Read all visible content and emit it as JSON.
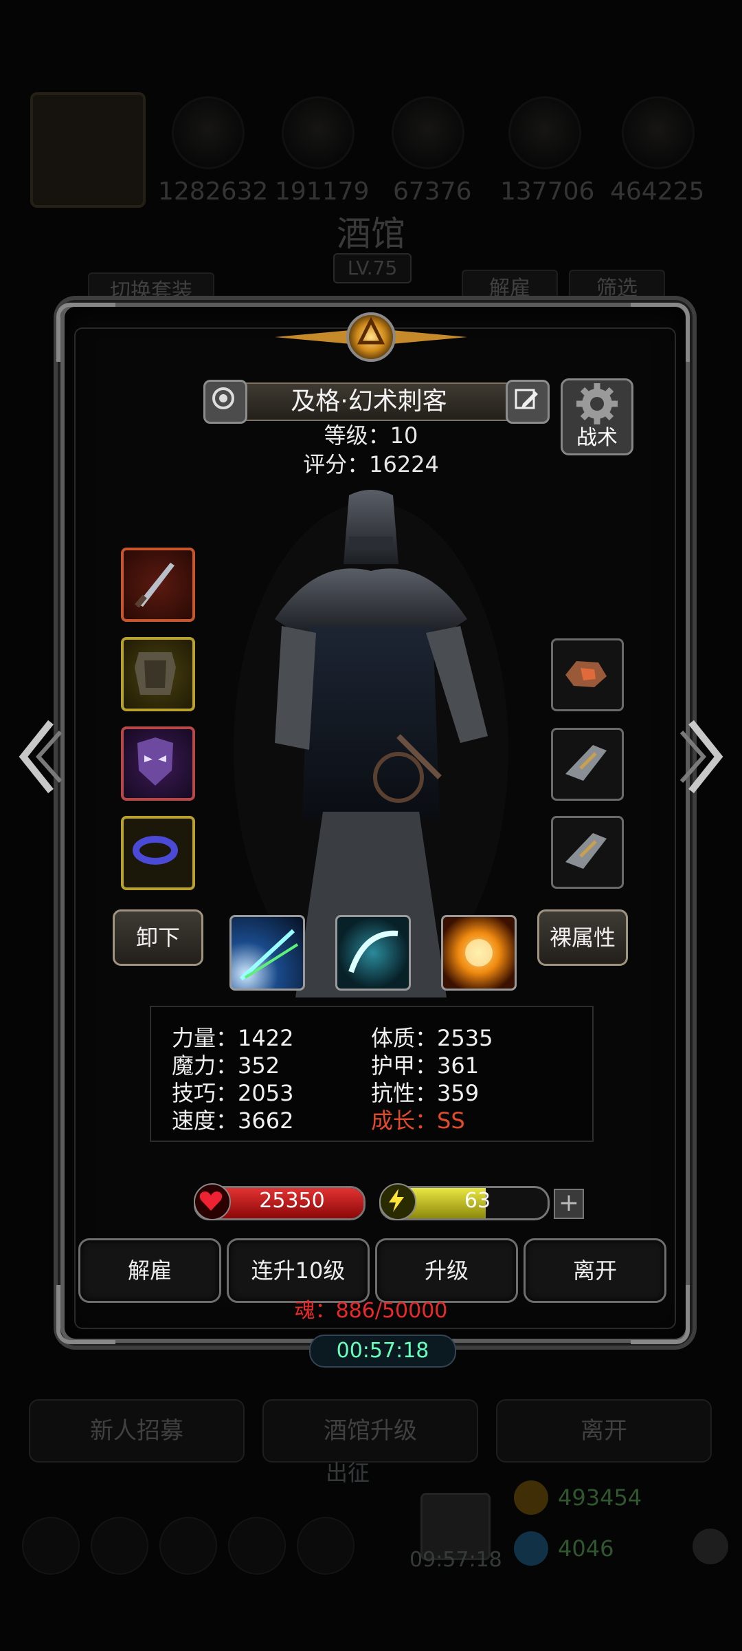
{
  "background": {
    "resources": [
      "1282632",
      "191179",
      "67376",
      "137706",
      "464225"
    ],
    "title": "酒馆",
    "level": "LV.75",
    "switch_outfit": "切换套装",
    "dismiss": "解雇",
    "filter": "筛选",
    "buttons": [
      "新人招募",
      "酒馆升级",
      "离开"
    ],
    "expedition": "出征",
    "gift_timer": "09:57:18",
    "gold": "493454",
    "gems": "4046"
  },
  "hero": {
    "name": "及格·幻术刺客",
    "level_text": "等级：10",
    "score_text": "评分：16224",
    "tactic_label": "战术",
    "unequip_label": "卸下",
    "base_attr_label": "裸属性"
  },
  "equipment": {
    "left": [
      "dagger-icon",
      "armor-icon",
      "mask-icon",
      "bracelet-icon"
    ],
    "right": [
      "ore-icon",
      "gauntlet-icon",
      "gauntlet-icon"
    ]
  },
  "skills": [
    "light-beam-skill-icon",
    "wind-slash-skill-icon",
    "fire-blast-skill-icon"
  ],
  "stats": {
    "strength": "力量：1422",
    "magic": "魔力：352",
    "skill": "技巧：2053",
    "speed": "速度：3662",
    "constitution": "体质：2535",
    "armor": "护甲：361",
    "resistance": "抗性：359",
    "growth": "成长：SS"
  },
  "bars": {
    "hp": "25350",
    "hp_fill_fraction": 1.0,
    "energy": "63",
    "energy_fill_fraction": 0.63
  },
  "actions": [
    "解雇",
    "连升10级",
    "升级",
    "离开"
  ],
  "soul": "魂：886/50000",
  "timer": "00:57:18",
  "colors": {
    "growth": "#e04b2c",
    "soul": "#ea2a2a",
    "hp": "#e23232",
    "energy": "#e9e542"
  }
}
